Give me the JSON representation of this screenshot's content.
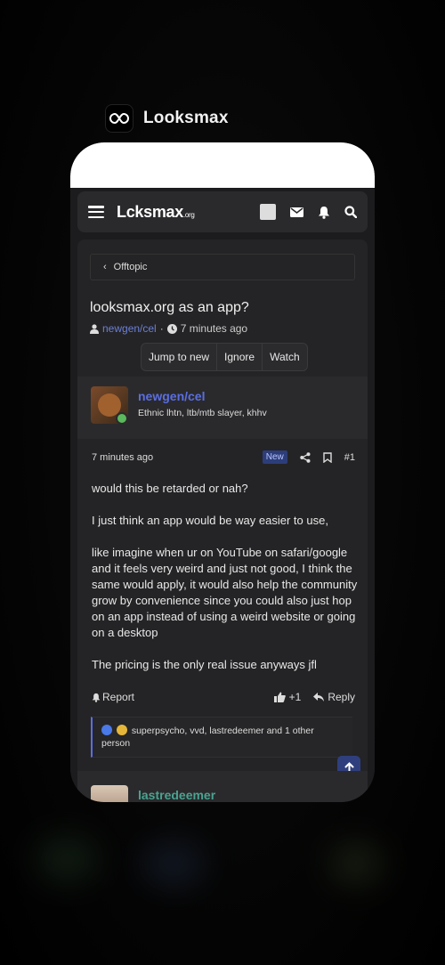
{
  "app": {
    "name": "Looksmax"
  },
  "nav": {
    "logo_main": "Lcksmax",
    "logo_tld": ".org"
  },
  "breadcrumb": {
    "label": "Offtopic"
  },
  "thread": {
    "title": "looksmax.org as an app?",
    "author": "newgen/cel",
    "separator": "·",
    "time": "7 minutes ago",
    "actions": [
      "Jump to new",
      "Ignore",
      "Watch"
    ]
  },
  "post": {
    "username": "newgen/cel",
    "user_title": "Ethnic lhtn, ltb/mtb slayer, khhv",
    "time": "7 minutes ago",
    "badge": "New",
    "number": "#1",
    "paragraphs": [
      "would this be retarded or nah?",
      "I just think an app would be way easier to use,",
      "like imagine when ur on YouTube on safari/google and it feels very weird and just not good, I think the same would apply, it would also help the community grow by convenience since you could also just hop on an app instead of using a weird website or going on a desktop",
      "The pricing is the only real issue anyways jfl"
    ],
    "report_label": "Report",
    "like_count": "+1",
    "reply_label": "Reply",
    "reactions_text": "superpsycho, vvd, lastredeemer and 1 other person"
  },
  "next_post": {
    "username": "lastredeemer"
  },
  "colors": {
    "accent": "#5b6ee1",
    "online": "#5cb85c",
    "username2": "#4aa391"
  }
}
